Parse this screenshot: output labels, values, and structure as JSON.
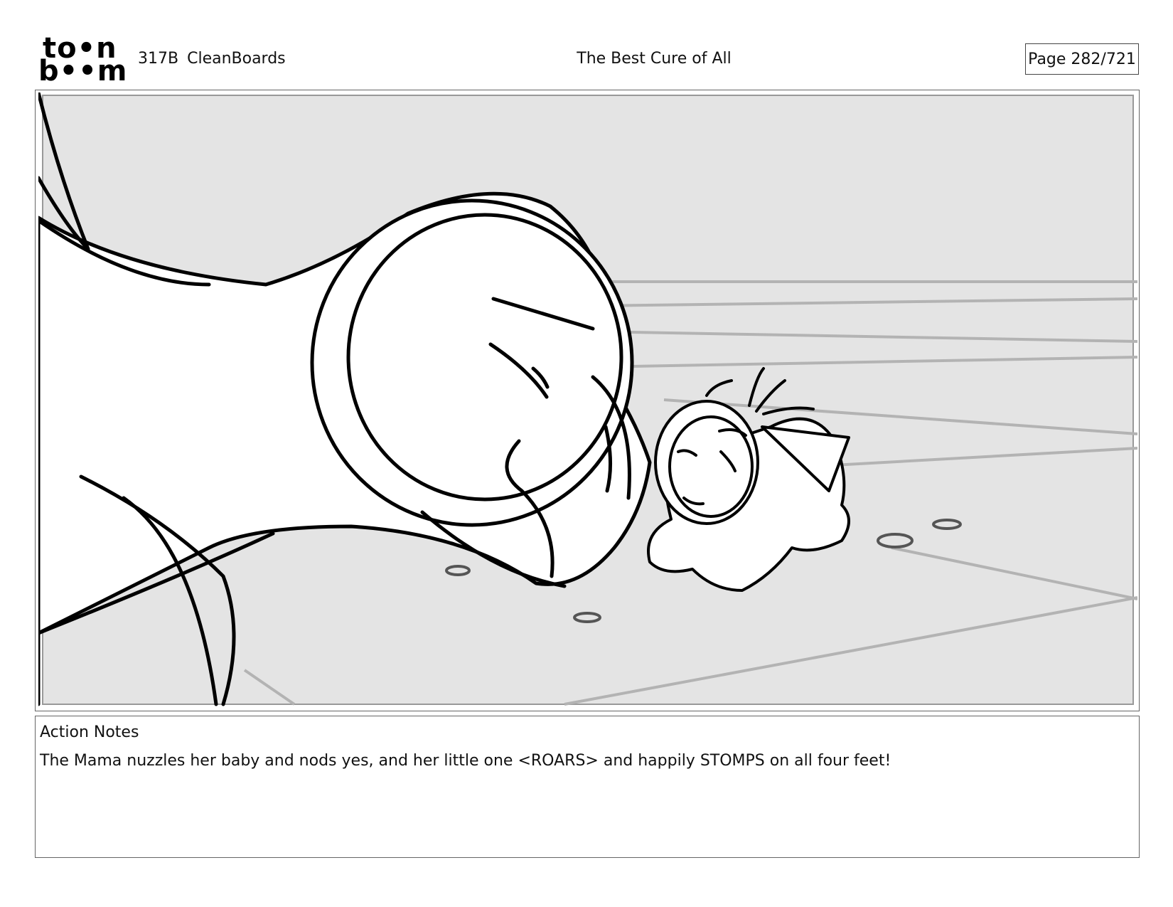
{
  "header": {
    "logo_line1": "to•n",
    "logo_line2": "b••m",
    "episode": "317B",
    "board_type": "CleanBoards",
    "title": "The Best Cure of All",
    "page_label": "Page 282/721"
  },
  "panel": {
    "icons": [
      "mama-creature-sketch",
      "baby-creature-sketch",
      "floor-perspective-lines",
      "dust-puff-marks"
    ],
    "background_color": "#e4e4e4"
  },
  "notes": {
    "heading": "Action Notes",
    "text": "The Mama nuzzles her baby and nods yes, and her little one <ROARS> and happily STOMPS on all four feet!"
  }
}
